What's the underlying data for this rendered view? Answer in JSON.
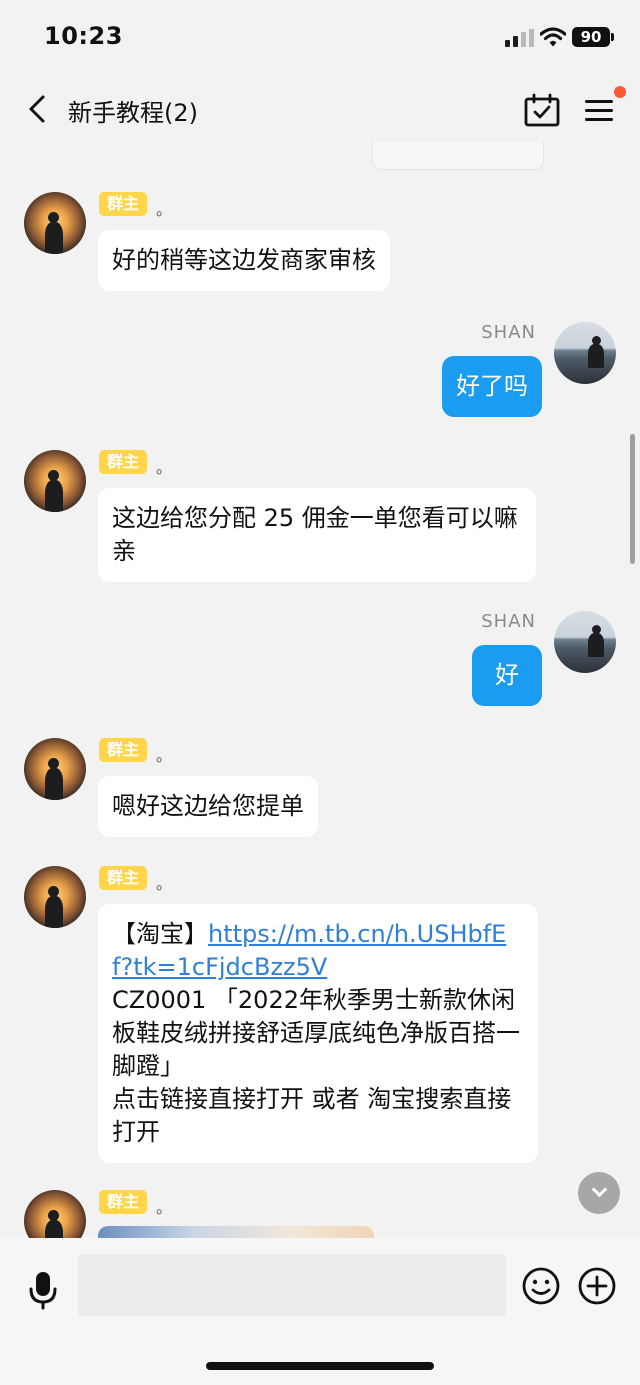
{
  "status_bar": {
    "time": "10:23",
    "battery": "90"
  },
  "nav": {
    "title": "新手教程(2)"
  },
  "badges": {
    "owner": "群主",
    "dot": "。"
  },
  "messages": {
    "m1": {
      "text": "好的稍等这边发商家审核"
    },
    "m2": {
      "sender": "SHAN",
      "text": "好了吗"
    },
    "m3": {
      "text": "这边给您分配 25 佣金一单您看可以嘛亲"
    },
    "m4": {
      "sender": "SHAN",
      "text": "好"
    },
    "m5": {
      "text": "嗯好这边给您提单"
    },
    "m6": {
      "prefix": "【淘宝】",
      "link": "https://m.tb.cn/h.USHbfEf?tk=1cFjdcBzz5V",
      "product": "CZ0001 「2022年秋季男士新款休闲板鞋皮绒拼接舒适厚底纯色净版百搭一脚蹬」",
      "hint": "点击链接直接打开 或者 淘宝搜索直接打开"
    }
  },
  "colors": {
    "outgoing_bubble": "#1a9cf0",
    "owner_badge": "#ffd64a",
    "link": "#2f7fd8",
    "notification_dot": "#ff5a36"
  },
  "icons": [
    "back-icon",
    "calendar-check-icon",
    "menu-icon",
    "mic-icon",
    "emoji-icon",
    "plus-icon",
    "chevron-down-icon"
  ]
}
